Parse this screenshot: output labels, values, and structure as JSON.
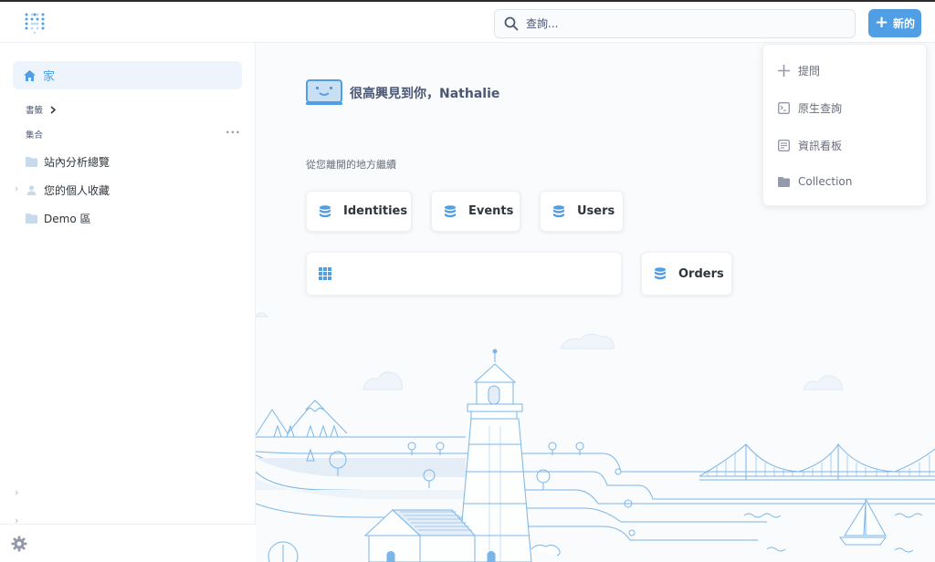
{
  "header": {
    "search_placeholder": "查詢...",
    "new_label": "新的"
  },
  "sidebar": {
    "home_label": "家",
    "bookmarks_label": "書籤",
    "collections_label": "集合",
    "collections": [
      {
        "label": "站內分析總覽"
      },
      {
        "label": "您的個人收藏"
      },
      {
        "label": "Demo 區"
      }
    ]
  },
  "main": {
    "greeting": "很高興見到你，Nathalie",
    "continue_label": "從您離開的地方繼續",
    "cards": [
      {
        "label": "Identities"
      },
      {
        "label": "Events"
      },
      {
        "label": "Users"
      },
      {
        "label": ""
      },
      {
        "label": "Orders"
      }
    ]
  },
  "new_menu": {
    "items": [
      {
        "label": "提問"
      },
      {
        "label": "原生查詢"
      },
      {
        "label": "資訊看板"
      },
      {
        "label": "Collection"
      }
    ]
  },
  "colors": {
    "brand": "#509ee3",
    "text": "#4c5773"
  }
}
